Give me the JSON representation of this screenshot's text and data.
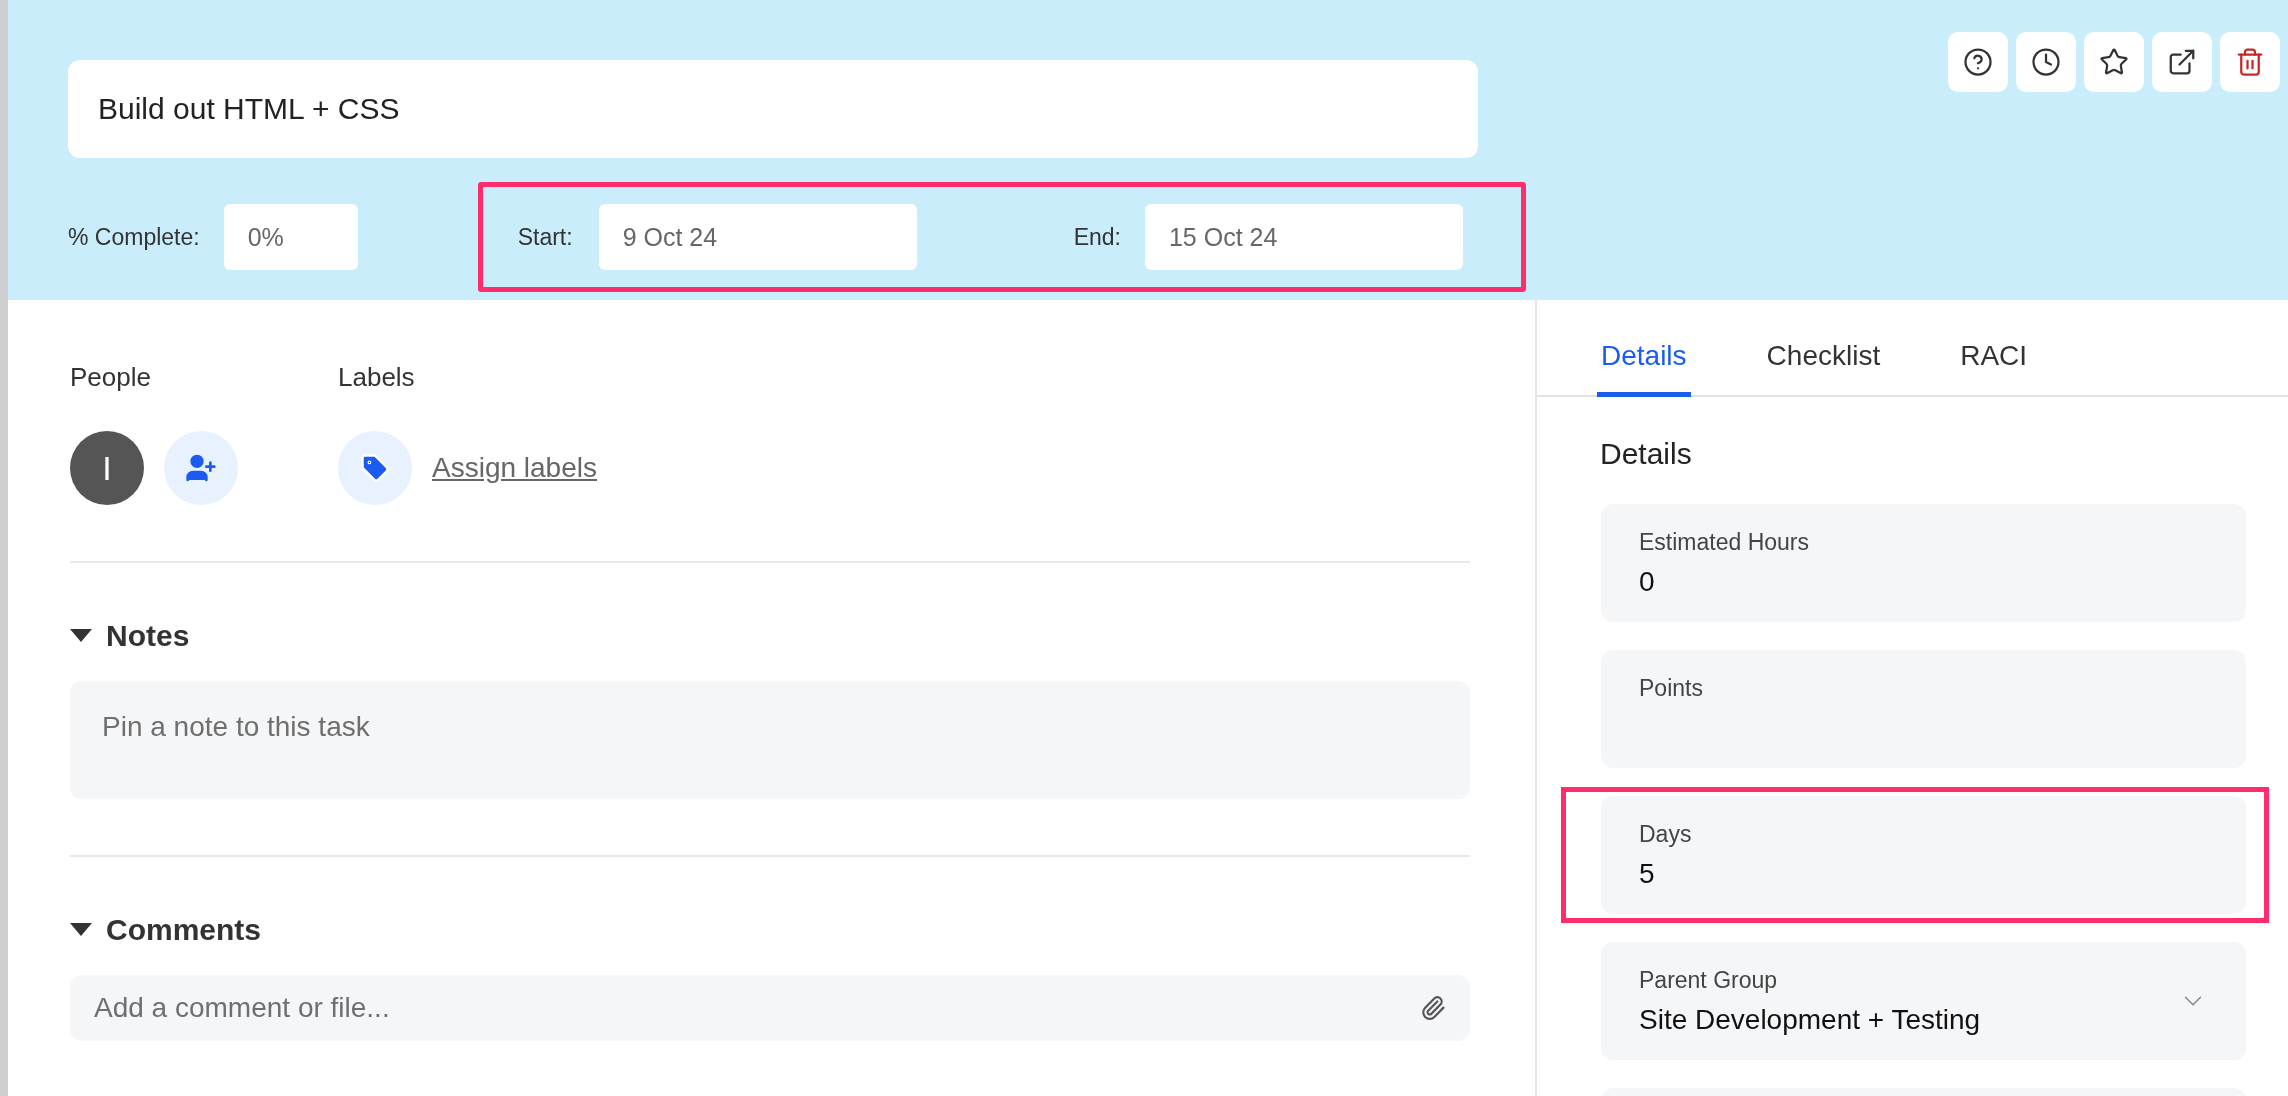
{
  "header": {
    "title": "Build out HTML + CSS",
    "complete": {
      "label": "% Complete:",
      "value": "0%"
    },
    "dates": {
      "highlighted": true,
      "start": {
        "label": "Start:",
        "value": "9 Oct 24"
      },
      "end": {
        "label": "End:",
        "value": "15 Oct 24"
      }
    },
    "actions": [
      {
        "kind": "help"
      },
      {
        "kind": "history"
      },
      {
        "kind": "star"
      },
      {
        "kind": "open"
      },
      {
        "kind": "delete"
      }
    ]
  },
  "people": {
    "heading": "People",
    "avatar": "I"
  },
  "labels": {
    "heading": "Labels",
    "link": "Assign labels"
  },
  "notes": {
    "heading": "Notes",
    "expanded": true,
    "placeholder": "Pin a note to this task"
  },
  "comments": {
    "heading": "Comments",
    "expanded": true,
    "placeholder": "Add a comment or file..."
  },
  "tabs": [
    {
      "label": "Details",
      "selected": true
    },
    {
      "label": "Checklist",
      "selected": false
    },
    {
      "label": "RACI",
      "selected": false
    }
  ],
  "details": {
    "heading": "Details",
    "fields": [
      {
        "kind": "text",
        "label": "Estimated Hours",
        "value": "0",
        "highlighted": false
      },
      {
        "kind": "text",
        "label": "Points",
        "highlighted": false
      },
      {
        "kind": "text",
        "label": "Days",
        "value": "5",
        "highlighted": true
      },
      {
        "kind": "select",
        "label": "Parent Group",
        "value": "Site Development + Testing",
        "highlighted": false
      },
      {
        "kind": "empty",
        "highlighted": false
      }
    ]
  }
}
